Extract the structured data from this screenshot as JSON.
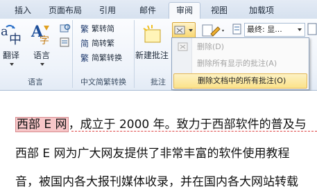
{
  "tabs": [
    {
      "label": "插入",
      "active": false
    },
    {
      "label": "页面布局",
      "active": false
    },
    {
      "label": "引用",
      "active": false
    },
    {
      "label": "邮件",
      "active": false
    },
    {
      "label": "审阅",
      "active": true
    },
    {
      "label": "视图",
      "active": false
    },
    {
      "label": "加载项",
      "active": false
    }
  ],
  "ribbon": {
    "language_group": {
      "label": "语言",
      "translate": "翻译",
      "language": "语言"
    },
    "chinese_conversion_group": {
      "label": "中文简繁转换",
      "to_simplified": "繁转简",
      "to_traditional": "简转繁",
      "convert": "简繁转换"
    },
    "comments_group": {
      "label": "批注",
      "new_comment": "新建批注"
    },
    "tracking": {
      "display_select": "最终: 显..."
    }
  },
  "delete_menu": {
    "items": [
      {
        "label": "删除(D)",
        "enabled": false
      },
      {
        "label": "删除所有显示的批注(A)",
        "enabled": false
      },
      {
        "label": "删除文档中的所有批注(O)",
        "enabled": true,
        "highlighted": true
      }
    ]
  },
  "document": {
    "line1_commented": "西部 E 网",
    "line1_rest": "，成立于 2000 年。致力于西部软件的普及与",
    "line2": "西部  E  网为广大网友提供了非常丰富的软件使用教程",
    "line3": "音，被国内各大报刊媒体收录，并在国内各大网站转载"
  },
  "colors": {
    "accent_highlight": "#fbe28a",
    "comment_highlight": "#f7c6c8",
    "comment_border": "#d44"
  }
}
